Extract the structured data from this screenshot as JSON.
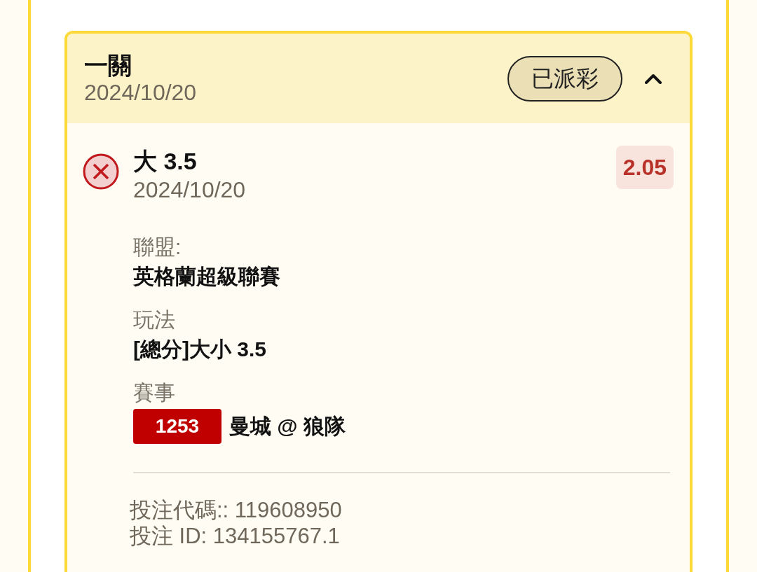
{
  "leg_card": {
    "title": "一關",
    "date": "2024/10/20",
    "status_badge": "已派彩",
    "expanded": true
  },
  "selection": {
    "name": "大 3.5",
    "date": "2024/10/20",
    "odds": "2.05",
    "won": false
  },
  "details": [
    {
      "label": "聯盟:",
      "value": "英格蘭超級聯賽"
    },
    {
      "label": "玩法",
      "value": "[總分]大小 3.5"
    },
    {
      "label": "賽事",
      "match_number": "1253",
      "value": "曼城 @ 狼隊"
    }
  ],
  "references": [
    "投注代碼:: 119608950",
    "投注 ID: 134155767.1"
  ]
}
